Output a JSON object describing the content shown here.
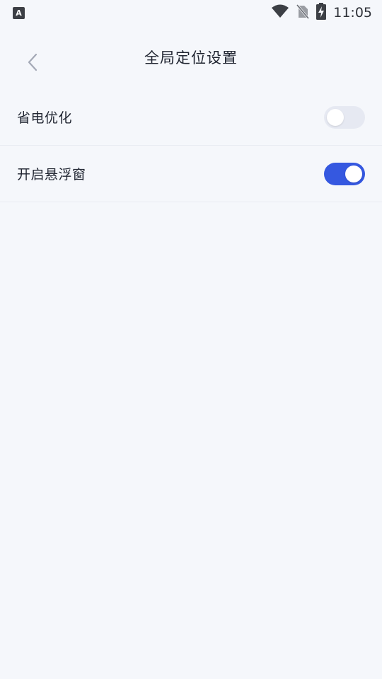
{
  "status_bar": {
    "notification_icon_letter": "A",
    "time": "11:05",
    "icons": [
      "wifi-icon",
      "no-sim-icon",
      "battery-charging-icon"
    ]
  },
  "header": {
    "title": "全局定位设置",
    "back_icon": "chevron-left-icon"
  },
  "settings": [
    {
      "label": "省电优化",
      "enabled": false
    },
    {
      "label": "开启悬浮窗",
      "enabled": true
    }
  ],
  "colors": {
    "background": "#f5f7fb",
    "toggle_on": "#3558e0",
    "toggle_off": "#e6e9f2"
  }
}
